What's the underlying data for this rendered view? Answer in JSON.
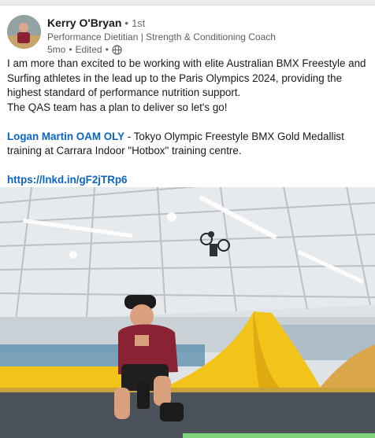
{
  "post": {
    "author": {
      "name": "Kerry O'Bryan",
      "separator": "•",
      "degree": "1st",
      "headline": "Performance Dietitian | Strength & Conditioning Coach",
      "time": "5mo",
      "edited": "Edited",
      "visibility_icon": "globe-icon"
    },
    "body": {
      "paragraph1": "I am more than excited to be working with elite Australian BMX Freestyle and Surfing athletes in the lead up to the Paris Olympics 2024, providing the highest standard of performance nutrition support.",
      "paragraph2": "The QAS team has a plan to deliver so let's go!",
      "mention": "Logan Martin OAM OLY",
      "mention_suffix": " - Tokyo Olympic Freestyle BMX Gold Medallist training at Carrara Indoor \"Hotbox\" training centre.",
      "link": "https://lnkd.in/gF2jTRp6"
    },
    "image": {
      "subject": "athlete-kneeling-indoor-bmx-arena",
      "colors": {
        "ramp": "#f2c419",
        "shirt": "#8a2234",
        "roof": "#e3e6ea",
        "floor": "#4b5158"
      }
    }
  }
}
